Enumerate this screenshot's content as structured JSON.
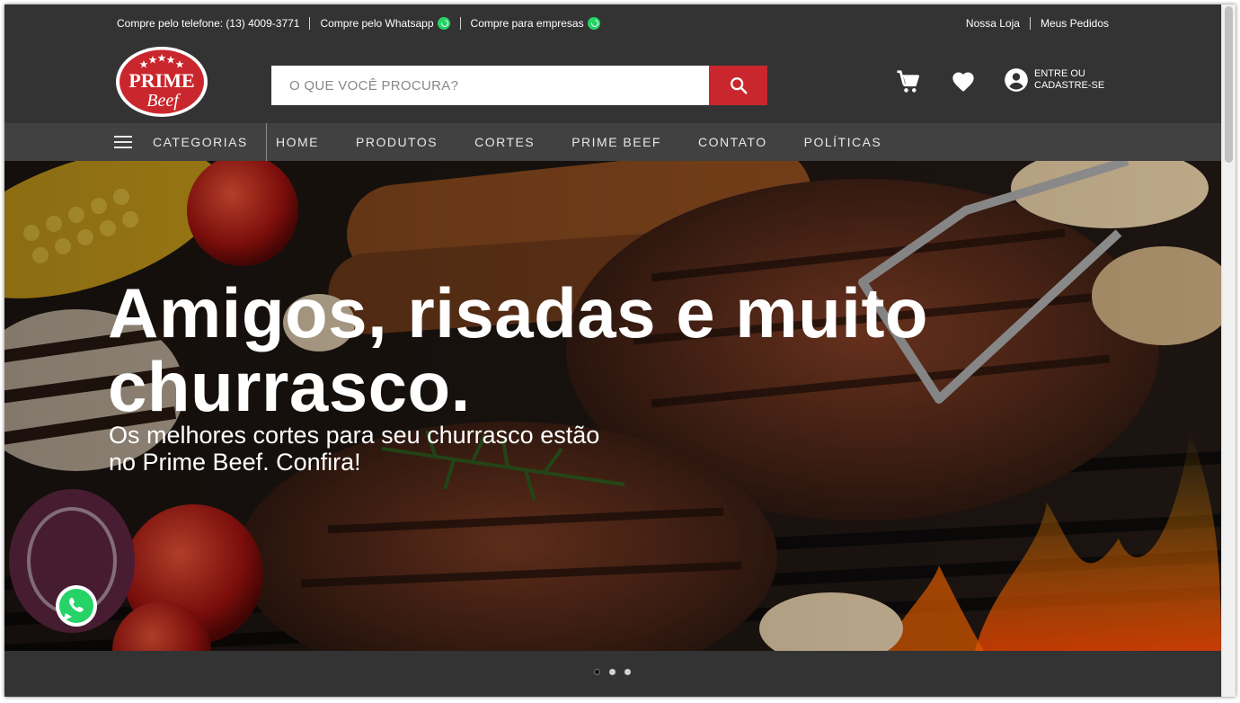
{
  "topbar": {
    "phone": "Compre pelo telefone: (13) 4009-3771",
    "whatsapp": "Compre pelo Whatsapp",
    "business": "Compre para empresas",
    "store": "Nossa Loja",
    "orders": "Meus Pedidos"
  },
  "logo": {
    "line1": "PRIME",
    "line2": "Beef"
  },
  "search": {
    "placeholder": "O QUE VOCÊ PROCURA?"
  },
  "account": {
    "label": "ENTRE OU CADASTRE-SE"
  },
  "nav": {
    "categories": "CATEGORIAS",
    "items": [
      {
        "label": "HOME"
      },
      {
        "label": "PRODUTOS"
      },
      {
        "label": "CORTES"
      },
      {
        "label": "PRIME BEEF"
      },
      {
        "label": "CONTATO"
      },
      {
        "label": "POLÍTICAS"
      }
    ]
  },
  "hero": {
    "title": "Amigos, risadas e muito churrasco.",
    "subtitle": "Os melhores cortes para seu churrasco estão no Prime Beef. Confira!"
  },
  "slider": {
    "count": 3,
    "active": 0
  },
  "colors": {
    "background": "#333333",
    "nav": "#414141",
    "accent": "#c9272d",
    "whatsapp": "#25d366"
  },
  "icons": [
    "whatsapp-icon",
    "search-icon",
    "cart-icon",
    "heart-icon",
    "account-icon",
    "menu-icon"
  ]
}
